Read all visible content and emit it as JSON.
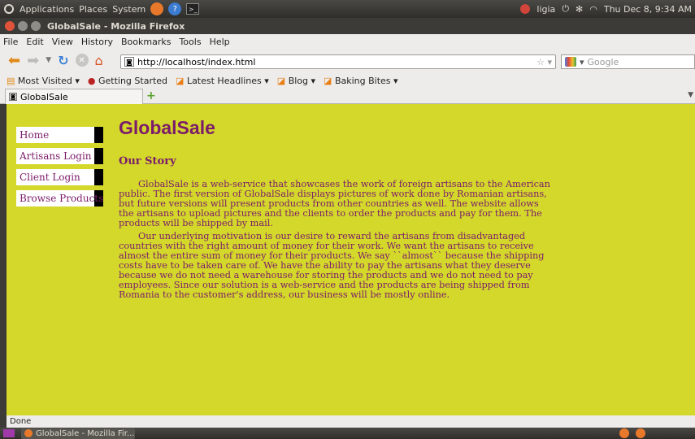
{
  "panel": {
    "menus": [
      "Applications",
      "Places",
      "System"
    ],
    "user": "ligia",
    "clock": "Thu Dec  8,  9:34 AM"
  },
  "window": {
    "title": "GlobalSale - Mozilla Firefox"
  },
  "menubar": [
    "File",
    "Edit",
    "View",
    "History",
    "Bookmarks",
    "Tools",
    "Help"
  ],
  "url": "http://localhost/index.html",
  "search_placeholder": "Google",
  "bookmarks": [
    {
      "label": "Most Visited ▾"
    },
    {
      "label": "Getting Started"
    },
    {
      "label": "Latest Headlines ▾"
    },
    {
      "label": "Blog ▾"
    },
    {
      "label": "Baking Bites ▾"
    }
  ],
  "tab": {
    "label": "GlobalSale"
  },
  "site": {
    "title": "GlobalSale",
    "nav": [
      "Home",
      "Artisans Login",
      "Client Login",
      "Browse Products"
    ],
    "heading": "Our Story",
    "paragraphs": [
      "GlobalSale is a web-service that showcases the work of foreign artisans to the American public. The first version of GlobalSale displays pictures of work done by Romanian artisans, but future versions will present products from other countries as well. The website allows the artisans to upload pictures and the clients to order the products and pay for them. The products will be shipped by mail.",
      "Our underlying motivation is our desire to reward the artisans from disadvantaged countries with the right amount of money for their work. We want the artisans to receive almost the entire sum of money for their products. We say ``almost`` because the shipping costs have to be taken care of. We have the ability to pay the artisans what they deserve because we do not need a warehouse for storing the products and we do not need to pay employees. Since our solution is a web-service and the products are being shipped from Romania to the customer's address, our business will be mostly online."
    ]
  },
  "status": "Done",
  "taskbar": {
    "task": "GlobalSale - Mozilla Fir..."
  },
  "colors": {
    "page_bg": "#d3d82b",
    "text": "#7b1b6a"
  }
}
